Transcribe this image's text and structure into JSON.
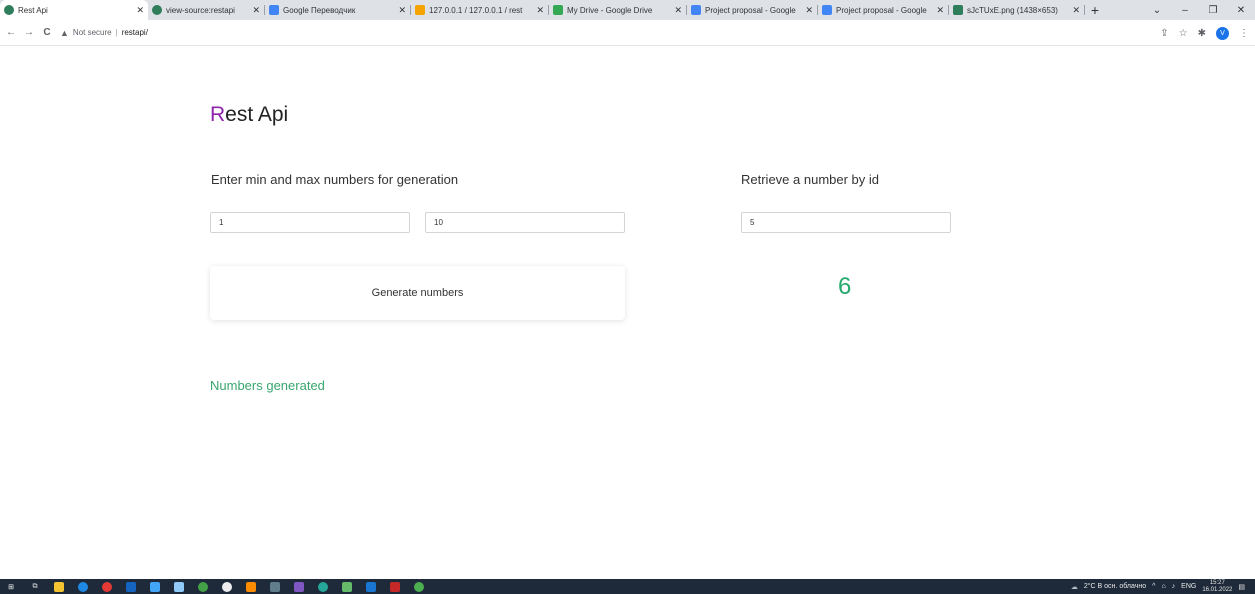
{
  "browser": {
    "tabs": [
      {
        "title": "Rest Api",
        "color": "#2e7d5b",
        "active": true
      },
      {
        "title": "view-source:restapi",
        "color": "#2e7d5b",
        "active": false
      },
      {
        "title": "Google Переводчик",
        "color": "#4285f4",
        "active": false
      },
      {
        "title": "127.0.0.1 / 127.0.0.1 / rest",
        "color": "#f4a300",
        "active": false
      },
      {
        "title": "My Drive - Google Drive",
        "color": "#34a853",
        "active": false
      },
      {
        "title": "Project proposal - Google",
        "color": "#4285f4",
        "active": false
      },
      {
        "title": "Project proposal - Google",
        "color": "#4285f4",
        "active": false
      },
      {
        "title": "sJcTUxE.png (1438×653)",
        "color": "#2e7d5b",
        "active": false
      }
    ],
    "new_tab_glyph": "+",
    "window_controls": {
      "dropdown": "⌄",
      "minimize": "–",
      "restore": "❐",
      "close": "✕"
    },
    "nav": {
      "back": "←",
      "forward": "→",
      "reload": "C"
    },
    "omnibox": {
      "security_icon": "▲",
      "security_text": "Not secure",
      "separator": "|",
      "url": "restapi/"
    },
    "toolbar_icons": {
      "share": "⇪",
      "star": "☆",
      "extensions": "✱",
      "profile_initial": "V",
      "menu": "⋮"
    }
  },
  "page": {
    "title_first_letter": "R",
    "title_rest": "est Api",
    "generate_section": {
      "heading": "Enter min and max numbers for generation",
      "min_value": "1",
      "max_value": "10",
      "button_label": "Generate numbers"
    },
    "retrieve_section": {
      "heading": "Retrieve a number by id",
      "id_value": "5",
      "result": "6"
    },
    "status_text": "Numbers generated"
  },
  "taskbar": {
    "icons": [
      "windows-start",
      "task-view",
      "file-explorer",
      "edge",
      "chrome",
      "terminal",
      "mail",
      "save",
      "app-green",
      "app-white",
      "app-orange",
      "calculator",
      "app-purple",
      "app-globe",
      "app-chat",
      "vscode",
      "filezilla",
      "app-green-2"
    ],
    "weather": "2°C В осн. облачно",
    "tray_chevron": "^",
    "language": "ENG",
    "time": "15:27",
    "date": "16.01.2022"
  },
  "colors": {
    "title_accent": "#8e24aa",
    "result_green": "#26a96c",
    "status_green": "#3aa66e"
  }
}
